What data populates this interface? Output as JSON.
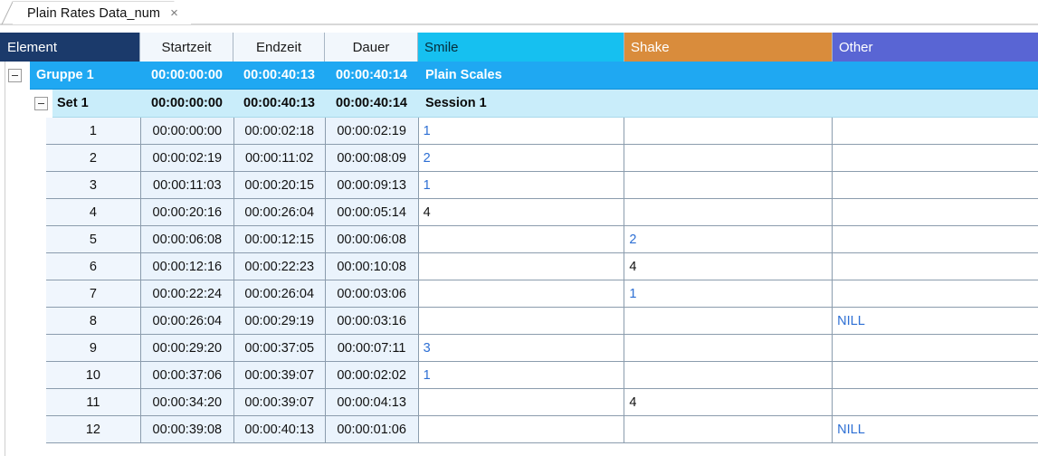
{
  "tab": {
    "title": "Plain Rates Data_num",
    "close_label": "×"
  },
  "grid": {
    "columns": [
      {
        "key": "element",
        "label": "Element",
        "color": "#1b3a6b"
      },
      {
        "key": "start",
        "label": "Startzeit",
        "color": "#f2f7fc"
      },
      {
        "key": "end",
        "label": "Endzeit",
        "color": "#f2f7fc"
      },
      {
        "key": "duration",
        "label": "Dauer",
        "color": "#f2f7fc"
      },
      {
        "key": "smile",
        "label": "Smile",
        "color": "#16c0f0"
      },
      {
        "key": "shake",
        "label": "Shake",
        "color": "#d98c3c"
      },
      {
        "key": "other",
        "label": "Other",
        "color": "#5965d4"
      }
    ],
    "group_row": {
      "expander": "−",
      "label": "Gruppe  1",
      "start": "00:00:00:00",
      "end": "00:00:40:13",
      "duration": "00:00:40:14",
      "name": "Plain Scales"
    },
    "set_row": {
      "expander": "−",
      "label": "Set  1",
      "start": "00:00:00:00",
      "end": "00:00:40:13",
      "duration": "00:00:40:14",
      "name": "Session 1"
    },
    "rows": [
      {
        "num": "1",
        "start": "00:00:00:00",
        "end": "00:00:02:18",
        "duration": "00:00:02:19",
        "smile": "1",
        "smile_style": "blue",
        "shake": "",
        "shake_style": "blue",
        "other": "",
        "other_style": "blue"
      },
      {
        "num": "2",
        "start": "00:00:02:19",
        "end": "00:00:11:02",
        "duration": "00:00:08:09",
        "smile": "2",
        "smile_style": "blue",
        "shake": "",
        "shake_style": "blue",
        "other": "",
        "other_style": "blue"
      },
      {
        "num": "3",
        "start": "00:00:11:03",
        "end": "00:00:20:15",
        "duration": "00:00:09:13",
        "smile": "1",
        "smile_style": "blue",
        "shake": "",
        "shake_style": "blue",
        "other": "",
        "other_style": "blue"
      },
      {
        "num": "4",
        "start": "00:00:20:16",
        "end": "00:00:26:04",
        "duration": "00:00:05:14",
        "smile": "4",
        "smile_style": "dark",
        "shake": "",
        "shake_style": "blue",
        "other": "",
        "other_style": "blue"
      },
      {
        "num": "5",
        "start": "00:00:06:08",
        "end": "00:00:12:15",
        "duration": "00:00:06:08",
        "smile": "",
        "smile_style": "blue",
        "shake": "2",
        "shake_style": "blue",
        "other": "",
        "other_style": "blue"
      },
      {
        "num": "6",
        "start": "00:00:12:16",
        "end": "00:00:22:23",
        "duration": "00:00:10:08",
        "smile": "",
        "smile_style": "blue",
        "shake": "4",
        "shake_style": "dark",
        "other": "",
        "other_style": "blue"
      },
      {
        "num": "7",
        "start": "00:00:22:24",
        "end": "00:00:26:04",
        "duration": "00:00:03:06",
        "smile": "",
        "smile_style": "blue",
        "shake": "1",
        "shake_style": "blue",
        "other": "",
        "other_style": "blue"
      },
      {
        "num": "8",
        "start": "00:00:26:04",
        "end": "00:00:29:19",
        "duration": "00:00:03:16",
        "smile": "",
        "smile_style": "blue",
        "shake": "",
        "shake_style": "blue",
        "other": "NILL",
        "other_style": "blue"
      },
      {
        "num": "9",
        "start": "00:00:29:20",
        "end": "00:00:37:05",
        "duration": "00:00:07:11",
        "smile": "3",
        "smile_style": "blue",
        "shake": "",
        "shake_style": "blue",
        "other": "",
        "other_style": "blue"
      },
      {
        "num": "10",
        "start": "00:00:37:06",
        "end": "00:00:39:07",
        "duration": "00:00:02:02",
        "smile": "1",
        "smile_style": "blue",
        "shake": "",
        "shake_style": "blue",
        "other": "",
        "other_style": "blue"
      },
      {
        "num": "11",
        "start": "00:00:34:20",
        "end": "00:00:39:07",
        "duration": "00:00:04:13",
        "smile": "",
        "smile_style": "blue",
        "shake": "4",
        "shake_style": "dark",
        "other": "",
        "other_style": "blue"
      },
      {
        "num": "12",
        "start": "00:00:39:08",
        "end": "00:00:40:13",
        "duration": "00:00:01:06",
        "smile": "",
        "smile_style": "blue",
        "shake": "",
        "shake_style": "blue",
        "other": "NILL",
        "other_style": "blue"
      }
    ]
  }
}
